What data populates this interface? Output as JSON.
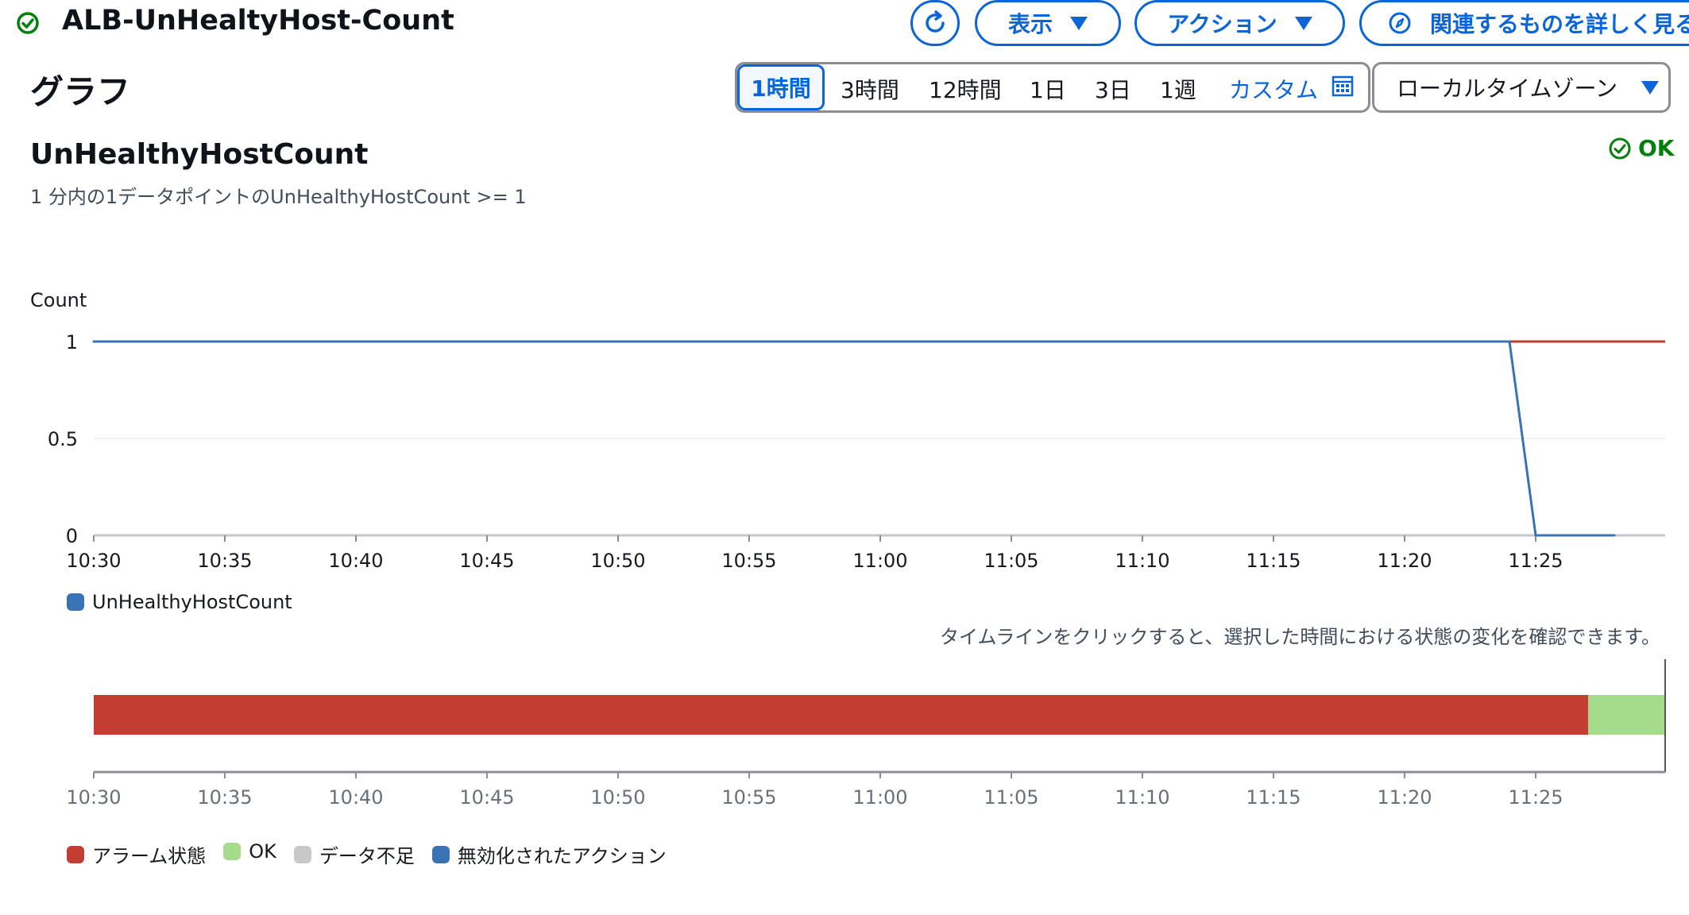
{
  "header": {
    "title": "ALB-UnHealtyHost-Count",
    "show_label": "表示",
    "action_label": "アクション",
    "related_label": "関連するものを詳しく見る"
  },
  "section_title": "グラフ",
  "time_ranges": [
    "1時間",
    "3時間",
    "12時間",
    "1日",
    "3日",
    "1週",
    "カスタム"
  ],
  "selected_range": "1時間",
  "timezone": "ローカルタイムゾーン",
  "metric": {
    "name": "UnHealthyHostCount",
    "condition": "1 分内の1データポイントのUnHealthyHostCount >= 1",
    "state": "OK"
  },
  "instructions": "タイムラインをクリックすると、選択した時間における状態の変化を確認できます。",
  "colors": {
    "accent": "#0a65d8",
    "series": "#3a73b5",
    "threshold": "#c33d32",
    "alarm": "#c33d32",
    "ok": "#a5dc8c",
    "insufficient": "#c8c8c8",
    "disabled": "#3a73b5",
    "ok_text": "#037f0c"
  },
  "chart_data": {
    "type": "line",
    "ylabel": "Count",
    "y_ticks": [
      "1",
      "0.5",
      "0"
    ],
    "ylim": [
      0,
      1
    ],
    "x_ticks": [
      "10:30",
      "10:35",
      "10:40",
      "10:45",
      "10:50",
      "10:55",
      "11:00",
      "11:05",
      "11:10",
      "11:15",
      "11:20",
      "11:25"
    ],
    "xlim": [
      "10:30",
      "11:30"
    ],
    "threshold": 1,
    "series": [
      {
        "name": "UnHealthyHostCount",
        "x": [
          "10:30",
          "11:24",
          "11:25",
          "11:28"
        ],
        "values": [
          1,
          1,
          0,
          0
        ]
      }
    ],
    "grid": true
  },
  "timeline": {
    "x_ticks": [
      "10:30",
      "10:35",
      "10:40",
      "10:45",
      "10:50",
      "10:55",
      "11:00",
      "11:05",
      "11:10",
      "11:15",
      "11:20",
      "11:25"
    ],
    "segments": [
      {
        "state": "alarm",
        "start": "10:30",
        "end": "11:27"
      },
      {
        "state": "ok",
        "start": "11:27",
        "end": "11:30"
      }
    ],
    "legend": [
      {
        "key": "alarm",
        "label": "アラーム状態"
      },
      {
        "key": "ok",
        "label": "OK"
      },
      {
        "key": "insufficient",
        "label": "データ不足"
      },
      {
        "key": "disabled",
        "label": "無効化されたアクション"
      }
    ]
  }
}
